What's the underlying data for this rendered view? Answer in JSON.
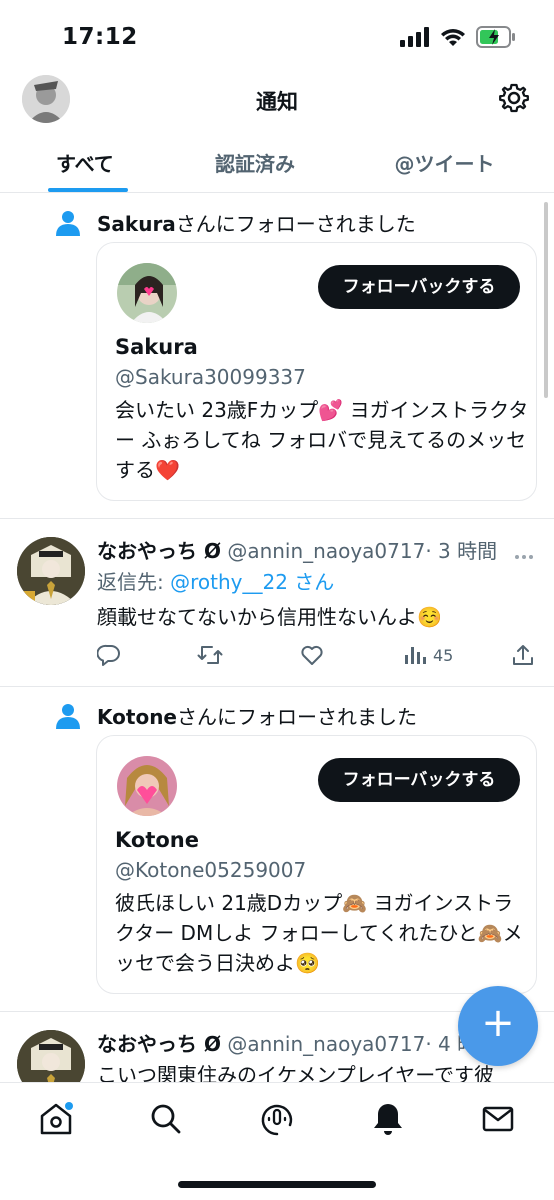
{
  "status_bar": {
    "time": "17:12"
  },
  "header": {
    "title": "通知"
  },
  "tabs": [
    {
      "label": "すべて",
      "active": true
    },
    {
      "label": "認証済み",
      "active": false
    },
    {
      "label": "@ツイート",
      "active": false
    }
  ],
  "notifications": [
    {
      "type": "follow",
      "follower_name": "Sakura",
      "followed_text": "さんにフォローされました",
      "button_label": "フォローバックする",
      "handle": "@Sakura30099337",
      "bio": "会いたい 23歳Fカップ💕 ヨガインストラクター ふぉろしてね フォロバで見えてるのメッセする❤️"
    },
    {
      "type": "tweet",
      "name": "なおやっち Ø",
      "handle": "@annin_naoya0717",
      "time": "· 3 時間",
      "reply_prefix": "返信先:",
      "reply_handle": "@rothy__22 さん",
      "text": "顔載せなてないから信用性ないんよ☺️",
      "views": "45"
    },
    {
      "type": "follow",
      "follower_name": "Kotone",
      "followed_text": "さんにフォローされました",
      "button_label": "フォローバックする",
      "handle": "@Kotone05259007",
      "bio": "彼氏ほしい 21歳Dカップ🙈 ヨガインストラクター DMしよ フォローしてくれたひと🙈メッセで会う日決めよ🥺"
    },
    {
      "type": "tweet",
      "name": "なおやっち Ø",
      "handle": "@annin_naoya0717",
      "time": "· 4 時",
      "text": "こいつ関東住みのイケメンプレイヤーです彼"
    }
  ],
  "fab": {
    "label": "+"
  },
  "icons": {
    "settings": "gear-icon",
    "follow": "person-icon",
    "reply": "reply-icon",
    "retweet": "retweet-icon",
    "like": "heart-icon",
    "views": "views-icon",
    "share": "share-icon",
    "more": "more-icon",
    "home": "home-icon",
    "search": "search-icon",
    "spaces": "spaces-icon",
    "notifications": "bell-icon",
    "messages": "mail-icon"
  },
  "colors": {
    "accent": "#1d9bf0",
    "fab": "#4a99e9",
    "text": "#0f1419",
    "muted": "#536471"
  }
}
